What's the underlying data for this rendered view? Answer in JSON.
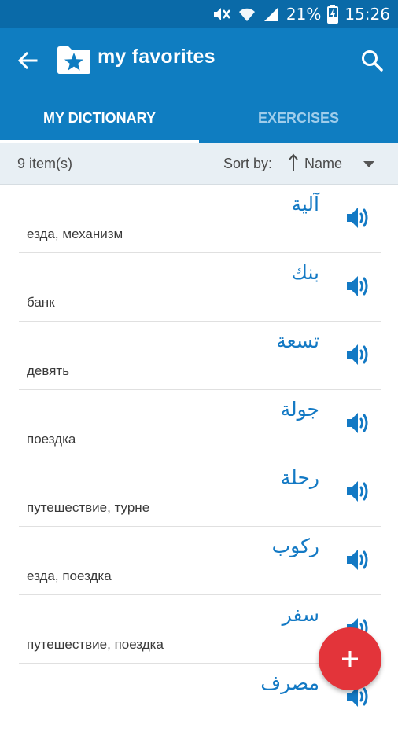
{
  "status_bar": {
    "battery": "21%",
    "time": "15:26"
  },
  "app_bar": {
    "title": "my favorites"
  },
  "tabs": [
    {
      "label": "MY DICTIONARY",
      "active": true
    },
    {
      "label": "EXERCISES",
      "active": false
    }
  ],
  "sort_bar": {
    "count": "9 item(s)",
    "sort_label": "Sort by:",
    "sort_value": "Name"
  },
  "items": [
    {
      "word": "آلية",
      "translation": "езда, механизм"
    },
    {
      "word": "بنك",
      "translation": "банк"
    },
    {
      "word": "تسعة",
      "translation": "девять"
    },
    {
      "word": "جولة",
      "translation": "поездка"
    },
    {
      "word": "رحلة",
      "translation": "путешествие, турне"
    },
    {
      "word": "ركوب",
      "translation": "езда, поездка"
    },
    {
      "word": "سفر",
      "translation": "путешествие, поездка"
    },
    {
      "word": "مصرف",
      "translation": ""
    }
  ],
  "colors": {
    "accent": "#0f7dc1",
    "status_bar": "#0a6aa8",
    "fab": "#e3343a",
    "word_text": "#1379c4"
  },
  "icons": {
    "back": "arrow-back-icon",
    "folder": "folder-star-icon",
    "search": "search-icon",
    "sort_arrow": "sort-ascending-icon",
    "caret": "dropdown-caret-icon",
    "speaker": "speaker-icon",
    "fab": "add-icon"
  }
}
